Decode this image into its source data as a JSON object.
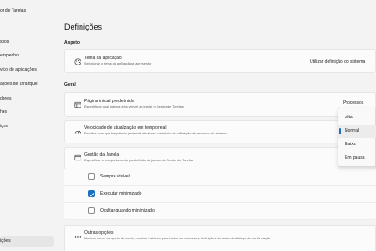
{
  "app": {
    "title": "or de Tarefas"
  },
  "sidebar": {
    "items": [
      {
        "label": "ssos"
      },
      {
        "label": "empenho"
      },
      {
        "label": "vico de aplicações"
      },
      {
        "label": "ações de arranque"
      },
      {
        "label": "dores"
      },
      {
        "label": "hes"
      },
      {
        "label": "iços"
      }
    ],
    "active_item": {
      "label": "ições"
    }
  },
  "page": {
    "title": "Definições",
    "sections": {
      "appearance": "Aspeto",
      "general": "Geral"
    }
  },
  "theme": {
    "title": "Tema da aplicação",
    "description": "Selecionar o tema da aplicação a apresentar",
    "value": "Utilizar definição do sistema"
  },
  "start_page": {
    "title": "Página inicial predefinida",
    "description": "Especifique qual página está visível ao iniciar o Gestor de Tarefas",
    "value": "Processos"
  },
  "update_speed": {
    "title": "Velocidade de atualização em tempo real",
    "description": "Escolha com que frequência pretende atualizar o relatório de utilização de recursos do sistema"
  },
  "window_mgmt": {
    "title": "Gestão da Janela",
    "description": "Especificar o comportamento predefinido da janela do Gestor de Tarefas",
    "options": [
      {
        "label": "Sempre visível",
        "checked": false
      },
      {
        "label": "Executar minimizado",
        "checked": true
      },
      {
        "label": "Ocultar quando minimizado",
        "checked": false
      }
    ]
  },
  "other": {
    "title": "Outras opções",
    "description": "Mostrar nome completo da conta, mostrar histórico para todos os processos, definições da caixa de diálogo de confirmação"
  },
  "speed_dropdown": {
    "options": [
      "Alta",
      "Normal",
      "Baixa",
      "Em pausa"
    ],
    "selected": "Normal"
  },
  "colors": {
    "accent": "#1a6fc0"
  }
}
